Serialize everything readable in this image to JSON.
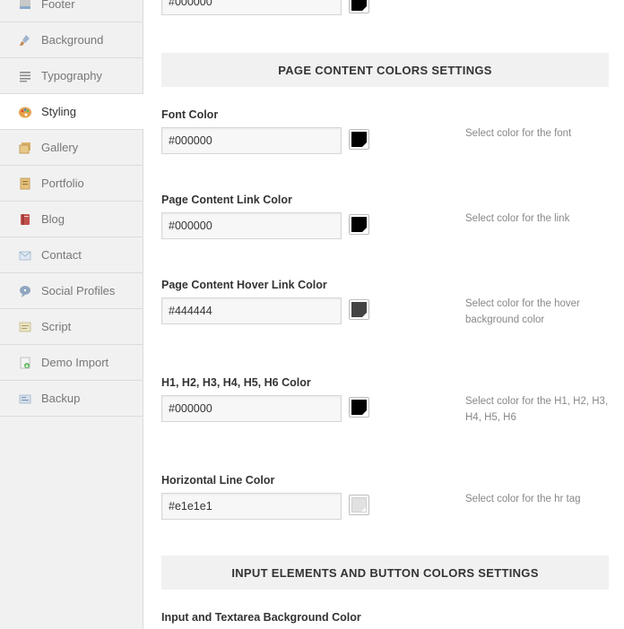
{
  "sidebar": {
    "items": [
      {
        "label": "Footer",
        "icon": "footer-icon"
      },
      {
        "label": "Background",
        "icon": "brush-icon"
      },
      {
        "label": "Typography",
        "icon": "text-lines-icon"
      },
      {
        "label": "Styling",
        "icon": "palette-icon",
        "active": true
      },
      {
        "label": "Gallery",
        "icon": "gallery-icon"
      },
      {
        "label": "Portfolio",
        "icon": "portfolio-icon"
      },
      {
        "label": "Blog",
        "icon": "book-icon"
      },
      {
        "label": "Contact",
        "icon": "envelope-icon"
      },
      {
        "label": "Social Profiles",
        "icon": "chat-bubble-icon"
      },
      {
        "label": "Script",
        "icon": "script-icon"
      },
      {
        "label": "Demo Import",
        "icon": "import-icon"
      },
      {
        "label": "Backup",
        "icon": "backup-icon"
      }
    ]
  },
  "top_field": {
    "value": "#000000",
    "swatch_color": "#000000"
  },
  "sections": {
    "page_content": {
      "title": "PAGE CONTENT COLORS SETTINGS"
    },
    "input_elements": {
      "title": "INPUT ELEMENTS AND BUTTON COLORS SETTINGS"
    }
  },
  "fields": [
    {
      "label": "Font Color",
      "value": "#000000",
      "swatch_color": "#000000",
      "description": "Select color for the font"
    },
    {
      "label": "Page Content Link Color",
      "value": "#000000",
      "swatch_color": "#000000",
      "description": "Select color for the link"
    },
    {
      "label": "Page Content Hover Link Color",
      "value": "#444444",
      "swatch_color": "#444444",
      "description": "Select color for the hover background color"
    },
    {
      "label": "H1, H2, H3, H4, H5, H6 Color",
      "value": "#000000",
      "swatch_color": "#000000",
      "description": "Select color for the H1, H2, H3, H4, H5, H6"
    },
    {
      "label": "Horizontal Line Color",
      "value": "#e1e1e1",
      "swatch_color": "#e1e1e1",
      "description": "Select color for the hr tag"
    }
  ],
  "next_field": {
    "label": "Input and Textarea Background Color"
  }
}
